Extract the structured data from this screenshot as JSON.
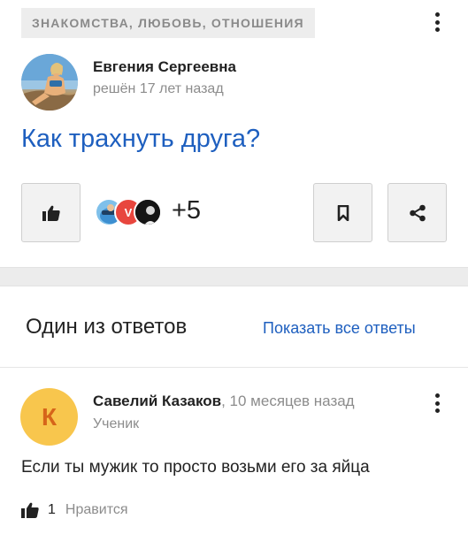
{
  "question": {
    "category": "ЗНАКОМСТВА, ЛЮБОВЬ, ОТНОШЕНИЯ",
    "author_name": "Евгения Сергеевна",
    "author_meta": "решён 17 лет назад",
    "title": "Как трахнуть друга?",
    "likers_more": "+5",
    "liker_avatar_letter": "V",
    "icons": {
      "menu": "more-vertical-icon",
      "like": "thumbs-up-icon",
      "bookmark": "bookmark-icon",
      "share": "share-icon"
    }
  },
  "answers_section": {
    "title": "Один из ответов",
    "show_all": "Показать все ответы"
  },
  "answer": {
    "avatar_letter": "К",
    "author_name": "Савелий Казаков",
    "separator": ",",
    "ago": " 10 месяцев назад",
    "rank": "Ученик",
    "text": "Если ты мужик то просто возьми его за яйца",
    "like_count": "1",
    "like_label": "Нравится"
  },
  "colors": {
    "link": "#1e5fbf",
    "muted": "#8c8c8c",
    "avatar_yellow": "#f8c64d",
    "avatar_letter": "#d6651a",
    "liker_red": "#e8463e"
  }
}
